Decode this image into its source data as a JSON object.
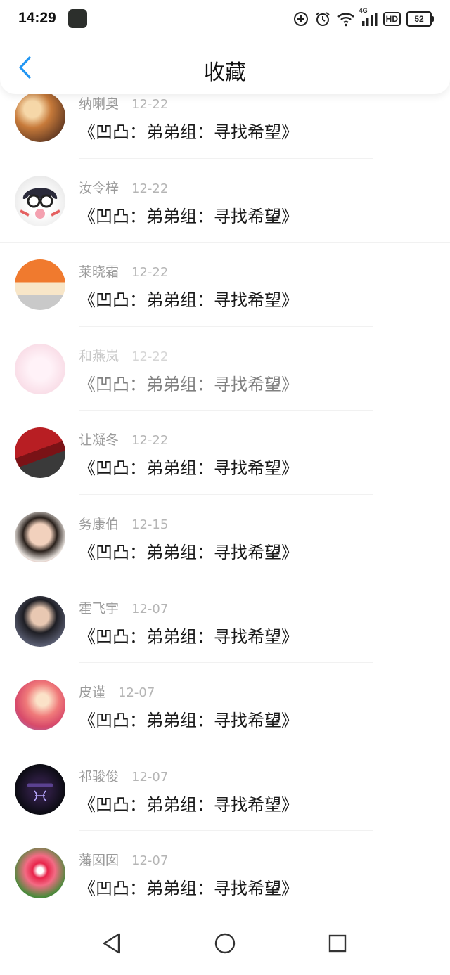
{
  "status_bar": {
    "time": "14:29",
    "network": "4G",
    "hd": "HD",
    "battery": "52"
  },
  "header": {
    "title": "收藏",
    "back_icon": "chevron-left-icon",
    "accent_color": "#2196f3"
  },
  "items": [
    {
      "name": "纳喇奥",
      "date": "12-22",
      "title": "《凹凸：弟弟组：寻找希望》"
    },
    {
      "name": "汝令梓",
      "date": "12-22",
      "title": "《凹凸：弟弟组：寻找希望》"
    },
    {
      "name": "莱晓霜",
      "date": "12-22",
      "title": "《凹凸：弟弟组：寻找希望》"
    },
    {
      "name": "和燕岚",
      "date": "12-22",
      "title": "《凹凸：弟弟组：寻找希望》"
    },
    {
      "name": "让凝冬",
      "date": "12-22",
      "title": "《凹凸：弟弟组：寻找希望》"
    },
    {
      "name": "务康伯",
      "date": "12-15",
      "title": "《凹凸：弟弟组：寻找希望》"
    },
    {
      "name": "霍飞宇",
      "date": "12-07",
      "title": "《凹凸：弟弟组：寻找希望》"
    },
    {
      "name": "皮谨",
      "date": "12-07",
      "title": "《凹凸：弟弟组：寻找希望》"
    },
    {
      "name": "祁骏俊",
      "date": "12-07",
      "title": "《凹凸：弟弟组：寻找希望》"
    },
    {
      "name": "藩囡囡",
      "date": "12-07",
      "title": "《凹凸：弟弟组：寻找希望》"
    }
  ],
  "nav_bar": {
    "back_icon": "triangle-back-icon",
    "home_icon": "circle-home-icon",
    "recents_icon": "square-recents-icon"
  }
}
